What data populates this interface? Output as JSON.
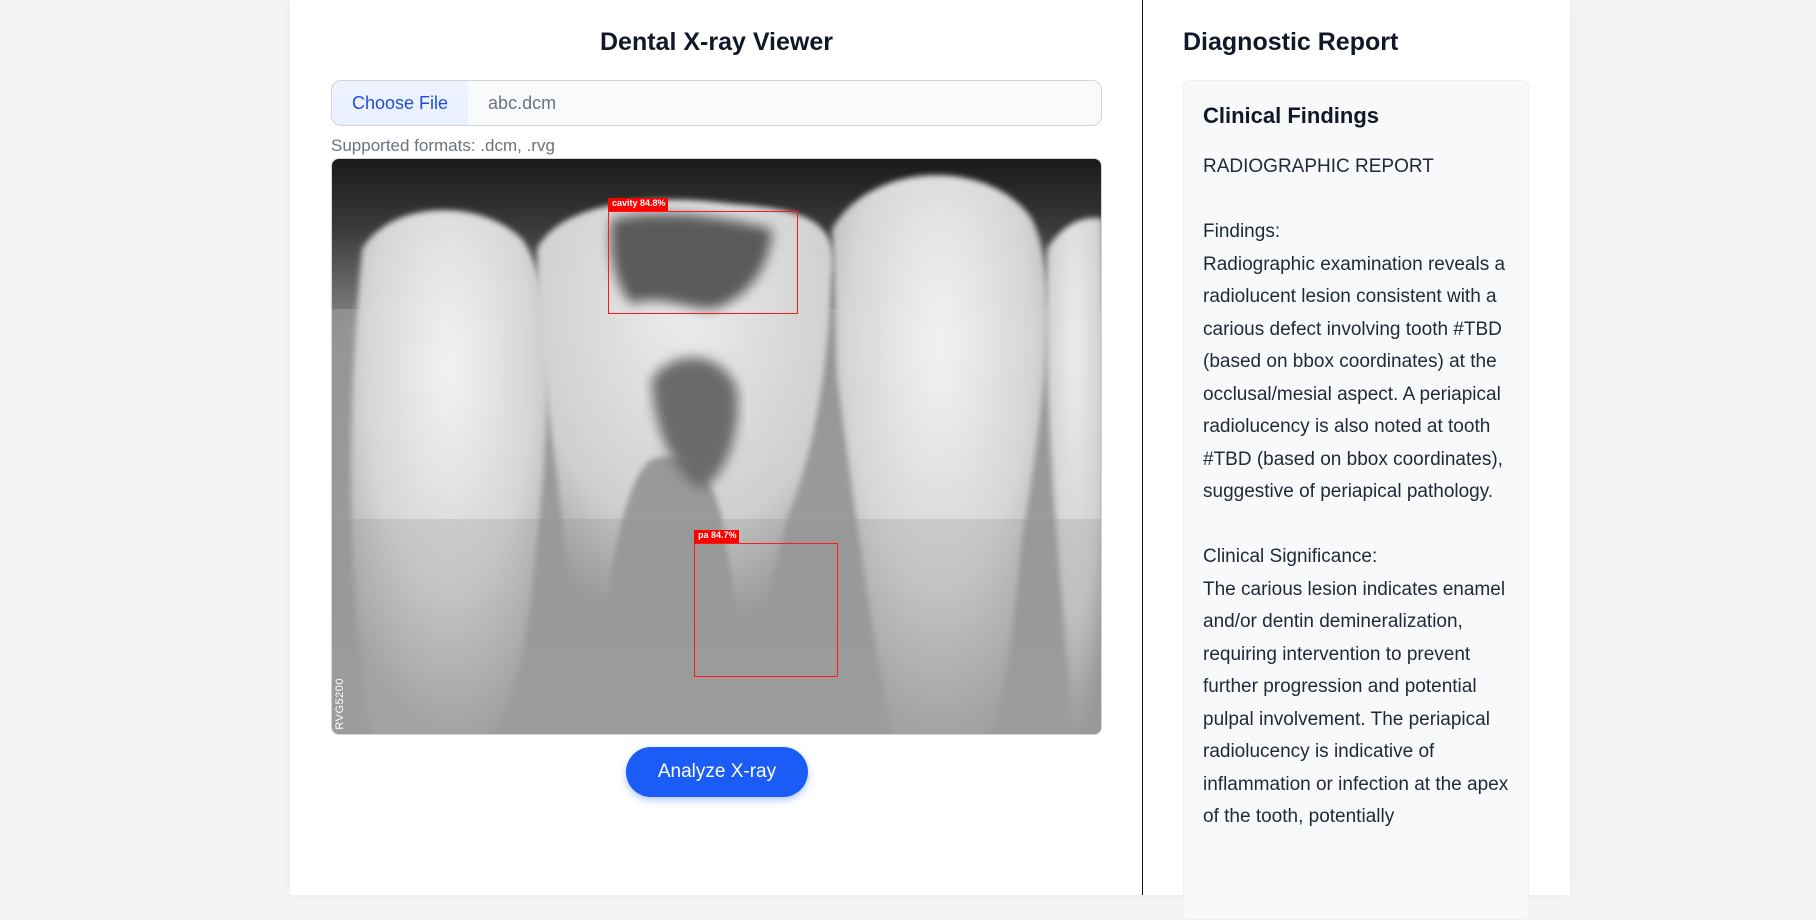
{
  "viewer": {
    "title": "Dental X-ray Viewer",
    "choose_file_label": "Choose File",
    "file_name": "abc.dcm",
    "supported_formats": "Supported formats: .dcm, .rvg",
    "watermark": "RVG5200",
    "detections": [
      {
        "label": "cavity 84.8%",
        "class": "cavity",
        "confidence": 84.8
      },
      {
        "label": "pa 84.7%",
        "class": "pa",
        "confidence": 84.7
      }
    ],
    "analyze_label": "Analyze X-ray"
  },
  "report": {
    "title": "Diagnostic Report",
    "card_title": "Clinical Findings",
    "heading": "RADIOGRAPHIC REPORT",
    "findings_label": "Findings:",
    "findings_text": "Radiographic examination reveals a radiolucent lesion consistent with a carious defect involving tooth #TBD (based on bbox coordinates) at the occlusal/mesial aspect. A periapical radiolucency is also noted at tooth #TBD (based on bbox coordinates), suggestive of periapical pathology.",
    "significance_label": "Clinical Significance:",
    "significance_text": "The carious lesion indicates enamel and/or dentin demineralization, requiring intervention to prevent further progression and potential pulpal involvement. The periapical radiolucency is indicative of inflammation or infection at the apex of the tooth, potentially"
  },
  "colors": {
    "accent": "#1a5cf5",
    "detection": "#ff0000",
    "link": "#1d4ed8"
  }
}
